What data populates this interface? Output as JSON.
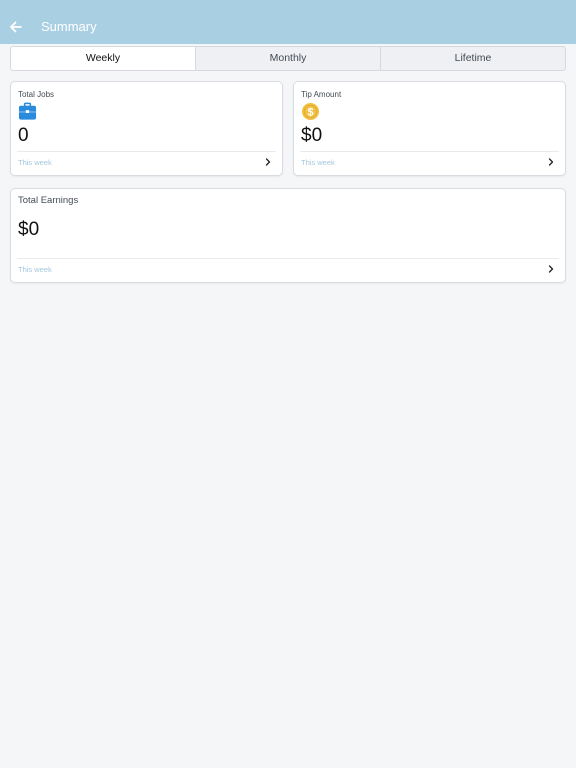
{
  "header": {
    "title": "Summary",
    "background": "#a9cfe3"
  },
  "tabs": [
    {
      "label": "Weekly",
      "active": true
    },
    {
      "label": "Monthly",
      "active": false
    },
    {
      "label": "Lifetime",
      "active": false
    }
  ],
  "cards": {
    "total_jobs": {
      "label": "Total Jobs",
      "icon": "briefcase-icon",
      "icon_color": "#2a8bdd",
      "value": "0",
      "footer": "This week"
    },
    "tip_amount": {
      "label": "Tip Amount",
      "icon": "dollar-coin-icon",
      "icon_color": "#f2c144",
      "value": "$0",
      "footer": "This week"
    },
    "total_earnings": {
      "label": "Total Earnings",
      "value": "$0",
      "footer": "This week"
    }
  }
}
